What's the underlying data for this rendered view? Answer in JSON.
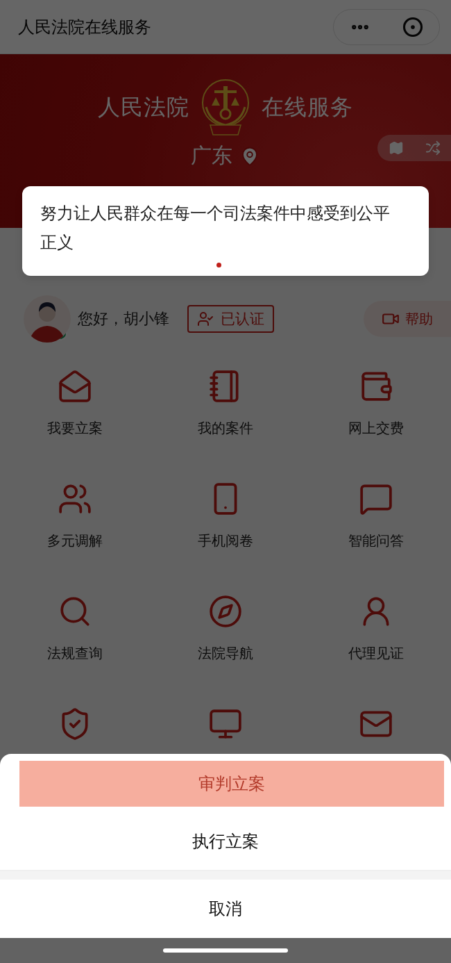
{
  "nav": {
    "title": "人民法院在线服务"
  },
  "banner": {
    "title_left": "人民法院",
    "title_right": "在线服务",
    "region": "广东",
    "slogan": "努力让人民群众在每一个司法案件中感受到公平正义",
    "dots": [
      {
        "selected": true
      }
    ]
  },
  "user": {
    "greeting": "您好，胡小锋",
    "verified": "已认证",
    "help": "帮助"
  },
  "services": [
    {
      "label": "我要立案"
    },
    {
      "label": "我的案件"
    },
    {
      "label": "网上交费"
    },
    {
      "label": "多元调解"
    },
    {
      "label": "手机阅卷"
    },
    {
      "label": "智能问答"
    },
    {
      "label": "法规查询"
    },
    {
      "label": "法院导航"
    },
    {
      "label": "代理见证"
    }
  ],
  "action_sheet": {
    "options": [
      {
        "label": "审判立案",
        "selected": true
      },
      {
        "label": "执行立案",
        "selected": false
      }
    ],
    "cancel": "取消"
  }
}
